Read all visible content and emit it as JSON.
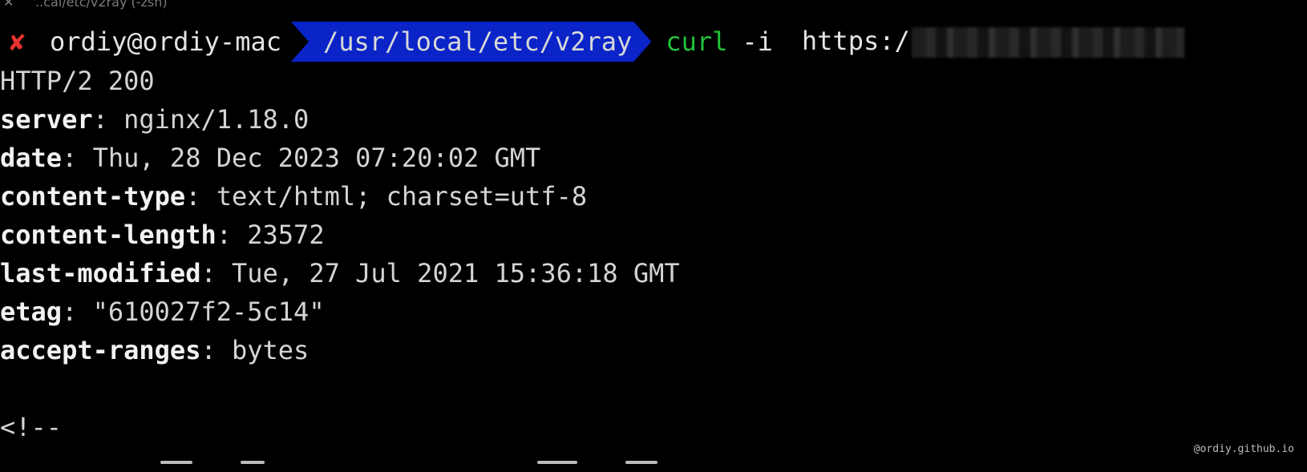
{
  "window": {
    "title": "..cal/etc/v2ray (-zsh)"
  },
  "prompt": {
    "status_icon": "x-mark-icon",
    "status_glyph": "✘",
    "user_host": "ordiy@ordiy-mac",
    "cwd": "/usr/local/etc/v2ray",
    "command": "curl",
    "args": "-i",
    "url_prefix": "https:/"
  },
  "output": {
    "status_line": "HTTP/2 200",
    "headers": [
      {
        "key": "server",
        "value": "nginx/1.18.0"
      },
      {
        "key": "date",
        "value": "Thu, 28 Dec 2023 07:20:02 GMT"
      },
      {
        "key": "content-type",
        "value": "text/html; charset=utf-8"
      },
      {
        "key": "content-length",
        "value": "23572"
      },
      {
        "key": "last-modified",
        "value": "Tue, 27 Jul 2021 15:36:18 GMT"
      },
      {
        "key": "etag",
        "value": "\"610027f2-5c14\""
      },
      {
        "key": "accept-ranges",
        "value": "bytes"
      }
    ],
    "body_start": "<!--"
  },
  "watermark": "@ordiy.github.io",
  "colors": {
    "background": "#000000",
    "path_segment": "#0a24c8",
    "command": "#23c23a",
    "error_mark": "#e8332e"
  }
}
